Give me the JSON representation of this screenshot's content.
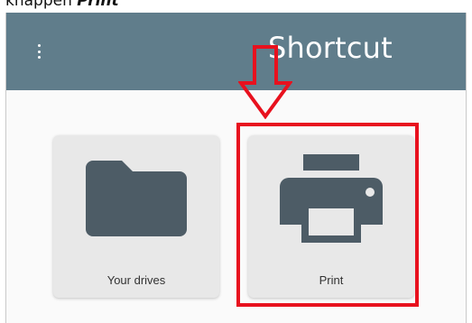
{
  "caption": {
    "prefix": "knappen ",
    "emphasis": "Print"
  },
  "toolbar": {
    "title": "Shortcut",
    "menu_icon": "more-vert-icon",
    "background_color": "#607d8b"
  },
  "tiles": [
    {
      "label": "Your drives",
      "icon": "folder-icon"
    },
    {
      "label": "Print",
      "icon": "printer-icon"
    }
  ],
  "annotation": {
    "color": "#e8111e",
    "arrow_icon": "down-arrow-icon"
  }
}
